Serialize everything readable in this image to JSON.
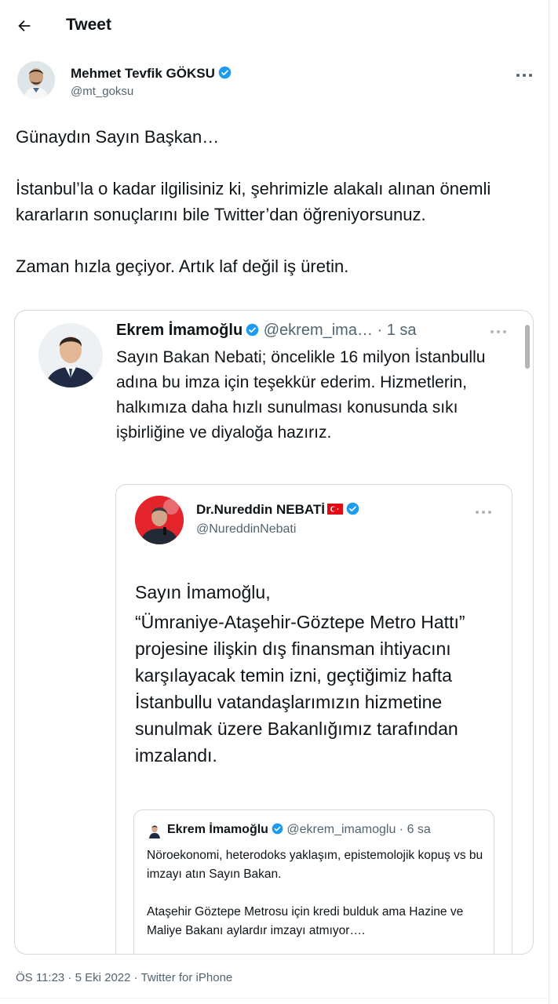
{
  "header": {
    "title": "Tweet"
  },
  "tweet": {
    "author": {
      "name": "Mehmet Tevfik GÖKSU",
      "handle": "@mt_goksu"
    },
    "paragraphs": [
      "Günaydın Sayın Başkan…",
      "İstanbul’la o kadar ilgilisiniz ki, şehrimizle alakalı alınan önemli kararların sonuçlarını bile Twitter’dan öğreniyorsunuz.",
      "Zaman hızla geçiyor. Artık laf değil iş üretin."
    ],
    "timestamp": "ÖS 11:23 · 5 Eki 2022 ·",
    "source": "Twitter for iPhone"
  },
  "quote1": {
    "name": "Ekrem İmamoğlu",
    "handle": "@ekrem_ima…",
    "time": "· 1 sa",
    "text": "Sayın Bakan Nebati; öncelikle 16 milyon İstanbullu adına bu imza için teşekkür ederim. Hizmetlerin, halkımıza daha hızlı sunulması konusunda sıkı işbirliğine ve diyaloğa hazırız."
  },
  "quote2": {
    "name": "Dr.Nureddin NEBATİ",
    "handle": "@NureddinNebati",
    "greeting": "Sayın İmamoğlu,",
    "body": "“Ümraniye-Ataşehir-Göztepe Metro Hattı” projesine ilişkin dış finansman ihtiyacını karşılayacak temin izni, geçtiğimiz hafta İstanbullu vatandaşlarımızın hizmetine sunulmak üzere Bakanlığımız tarafından imzalandı."
  },
  "quote3": {
    "name": "Ekrem İmamoğlu",
    "handle": "@ekrem_imamoglu",
    "time": "· 6 sa",
    "para1": "Nöroekonomi, heterodoks yaklaşım, epistemolojik kopuş vs bu imzayı atın Sayın Bakan.",
    "para2": "Ataşehir Göztepe Metrosu için kredi bulduk ama Hazine ve Maliye Bakanı aylardır imzayı atmıyor…."
  },
  "colors": {
    "verified": "#1d9bf0",
    "secondary_text": "#536471",
    "border": "#cfd9de",
    "flag_red": "#e30a17"
  },
  "icons": [
    "back-arrow-icon",
    "verified-badge-icon",
    "more-options-icon",
    "turkish-flag-icon"
  ]
}
